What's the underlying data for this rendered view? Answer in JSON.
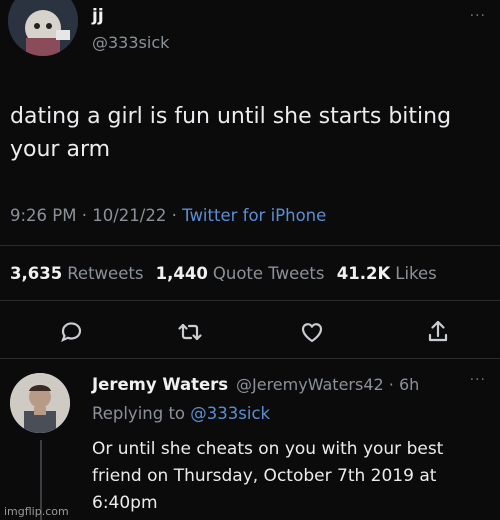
{
  "tweet": {
    "display_name": "jj",
    "handle": "@333sick",
    "more": "···",
    "text": "dating a girl is fun until she starts biting your arm",
    "time": "9:26 PM",
    "date": "10/21/22",
    "source": "Twitter for iPhone",
    "stats": {
      "retweets_count": "3,635",
      "retweets_label": "Retweets",
      "quotes_count": "1,440",
      "quotes_label": "Quote Tweets",
      "likes_count": "41.2K",
      "likes_label": "Likes"
    }
  },
  "actions": [
    {
      "icon": "comment-icon"
    },
    {
      "icon": "retweet-icon"
    },
    {
      "icon": "heart-icon"
    },
    {
      "icon": "share-icon"
    }
  ],
  "reply": {
    "display_name": "Jeremy Waters",
    "handle_time": "@JeremyWaters42 · 6h",
    "more": "···",
    "replying_prefix": "Replying to",
    "replying_to": "@333sick",
    "text": "Or until she cheats on you with your best friend on Thursday, October 7th 2019 at 6:40pm"
  },
  "watermark": "imgflip.com",
  "colors": {
    "background": "#0b0b0c",
    "link": "#5a8fd6",
    "muted": "#8b9198"
  }
}
